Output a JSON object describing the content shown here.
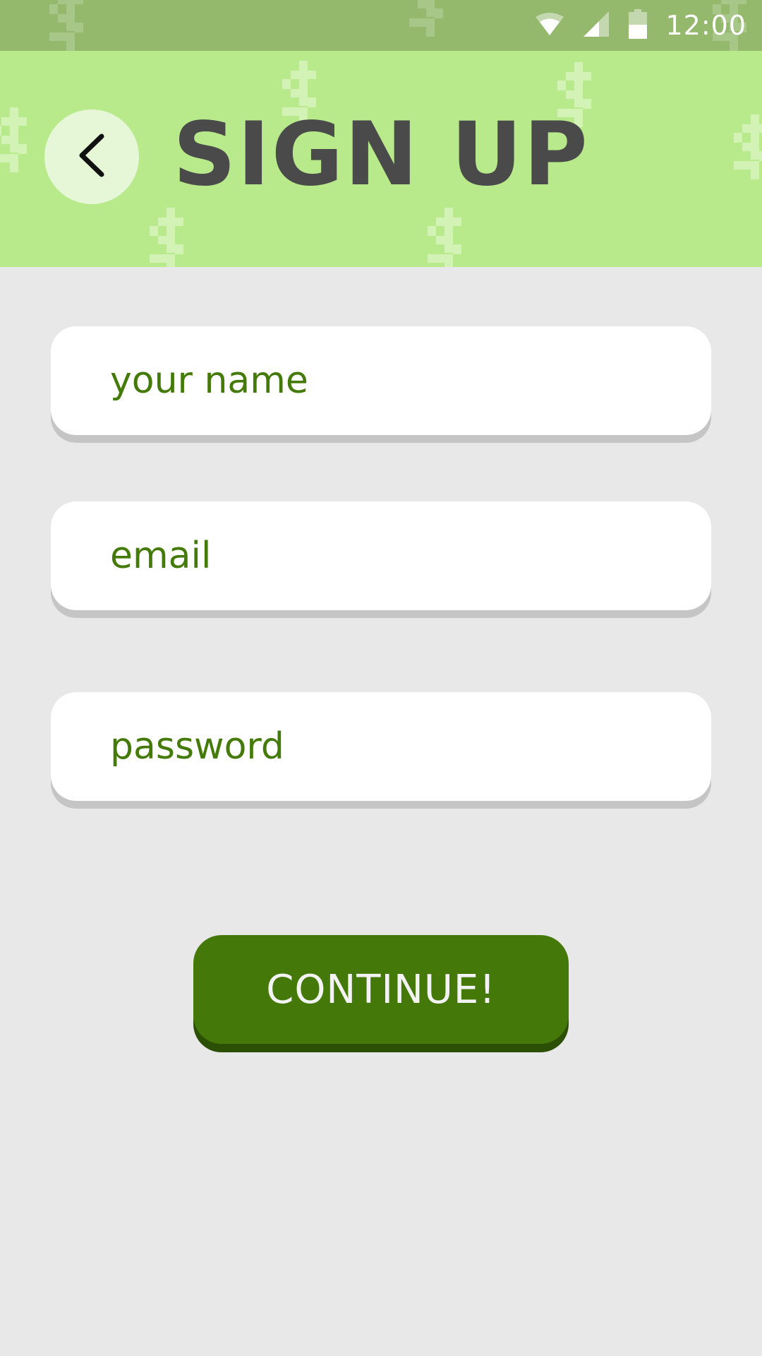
{
  "status_bar": {
    "time": "12:00",
    "icons": [
      "wifi-icon",
      "cell-signal-icon",
      "battery-icon"
    ],
    "background": "#94b96d"
  },
  "header": {
    "title": "SIGN UP",
    "back_icon": "chevron-left-icon",
    "background": "#b8e98a",
    "pattern_icon": "dollar-sign-icon"
  },
  "form": {
    "name_placeholder": "your name",
    "email_placeholder": "email",
    "password_placeholder": "password",
    "text_color": "#437a08"
  },
  "actions": {
    "continue_label": "CONTINUE!",
    "button_color": "#447808"
  }
}
